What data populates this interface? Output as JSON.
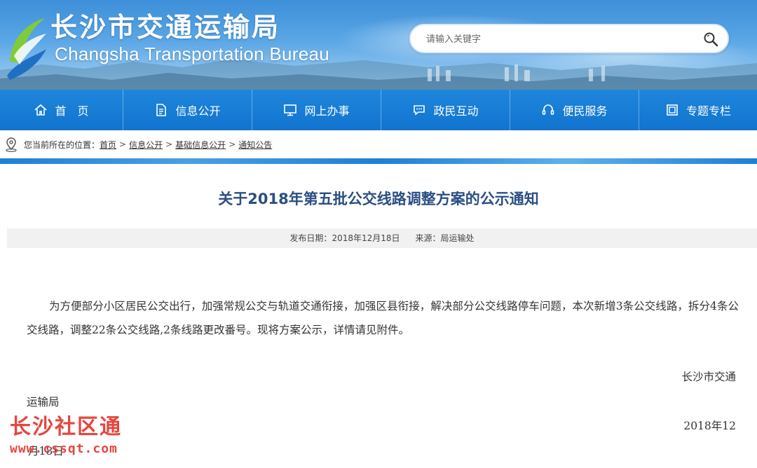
{
  "header": {
    "title_cn": "长沙市交通运输局",
    "title_en": "Changsha Transportation Bureau",
    "logo_icon": "changsha-transport-logo-icon",
    "search": {
      "placeholder": "请输入关键字",
      "icon": "search-icon"
    }
  },
  "nav": {
    "items": [
      {
        "label": "首　页",
        "icon": "home-icon"
      },
      {
        "label": "信息公开",
        "icon": "document-icon"
      },
      {
        "label": "网上办事",
        "icon": "monitor-icon"
      },
      {
        "label": "政民互动",
        "icon": "chat-icon"
      },
      {
        "label": "便民服务",
        "icon": "headset-icon"
      },
      {
        "label": "专题专栏",
        "icon": "columns-icon"
      }
    ]
  },
  "breadcrumb": {
    "prefix": "您当前所在的位置：",
    "items": [
      "首页",
      "信息公开",
      "基础信息公开",
      "通知公告"
    ],
    "separator": ">"
  },
  "article": {
    "title": "关于2018年第五批公交线路调整方案的公示通知",
    "meta": {
      "date_label": "发布日期：",
      "date": "2018年12月18日",
      "source_label": "来源：",
      "source": "局运输处"
    },
    "body": "为方便部分小区居民公交出行，加强常规公交与轨道交通衔接，加强区县衔接，解决部分公交线路停车问题，本次新增3条公交线路，拆分4条公交线路，调整22条公交线路,2条线路更改番号。现将方案公示，详情请见附件。",
    "signature_line1": "长沙市交通",
    "signature_line2": "运输局",
    "date_line1": "2018年12",
    "date_line2": "月18日"
  },
  "watermark": {
    "name": "长沙社区通",
    "url": "www.cssqt.com"
  },
  "colors": {
    "nav_blue": "#1174cf",
    "title_blue": "#2a4f82",
    "watermark_red": "#e8463f"
  }
}
